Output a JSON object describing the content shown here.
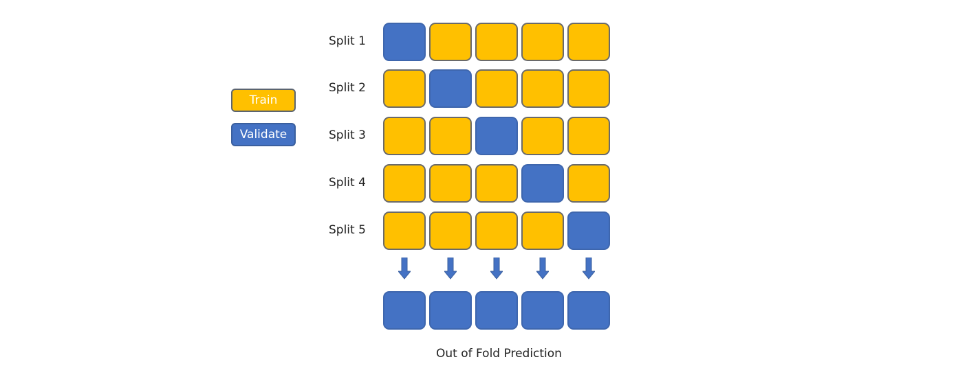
{
  "legend": {
    "train": "Train",
    "validate": "Validate"
  },
  "colors": {
    "train": "#ffc000",
    "validate": "#4472c4"
  },
  "splits": [
    {
      "label": "Split 1",
      "cells": [
        "validate",
        "train",
        "train",
        "train",
        "train"
      ]
    },
    {
      "label": "Split 2",
      "cells": [
        "train",
        "validate",
        "train",
        "train",
        "train"
      ]
    },
    {
      "label": "Split 3",
      "cells": [
        "train",
        "train",
        "validate",
        "train",
        "train"
      ]
    },
    {
      "label": "Split 4",
      "cells": [
        "train",
        "train",
        "train",
        "validate",
        "train"
      ]
    },
    {
      "label": "Split 5",
      "cells": [
        "train",
        "train",
        "train",
        "train",
        "validate"
      ]
    }
  ],
  "oof_cells": [
    "validate",
    "validate",
    "validate",
    "validate",
    "validate"
  ],
  "caption": "Out of Fold Prediction"
}
